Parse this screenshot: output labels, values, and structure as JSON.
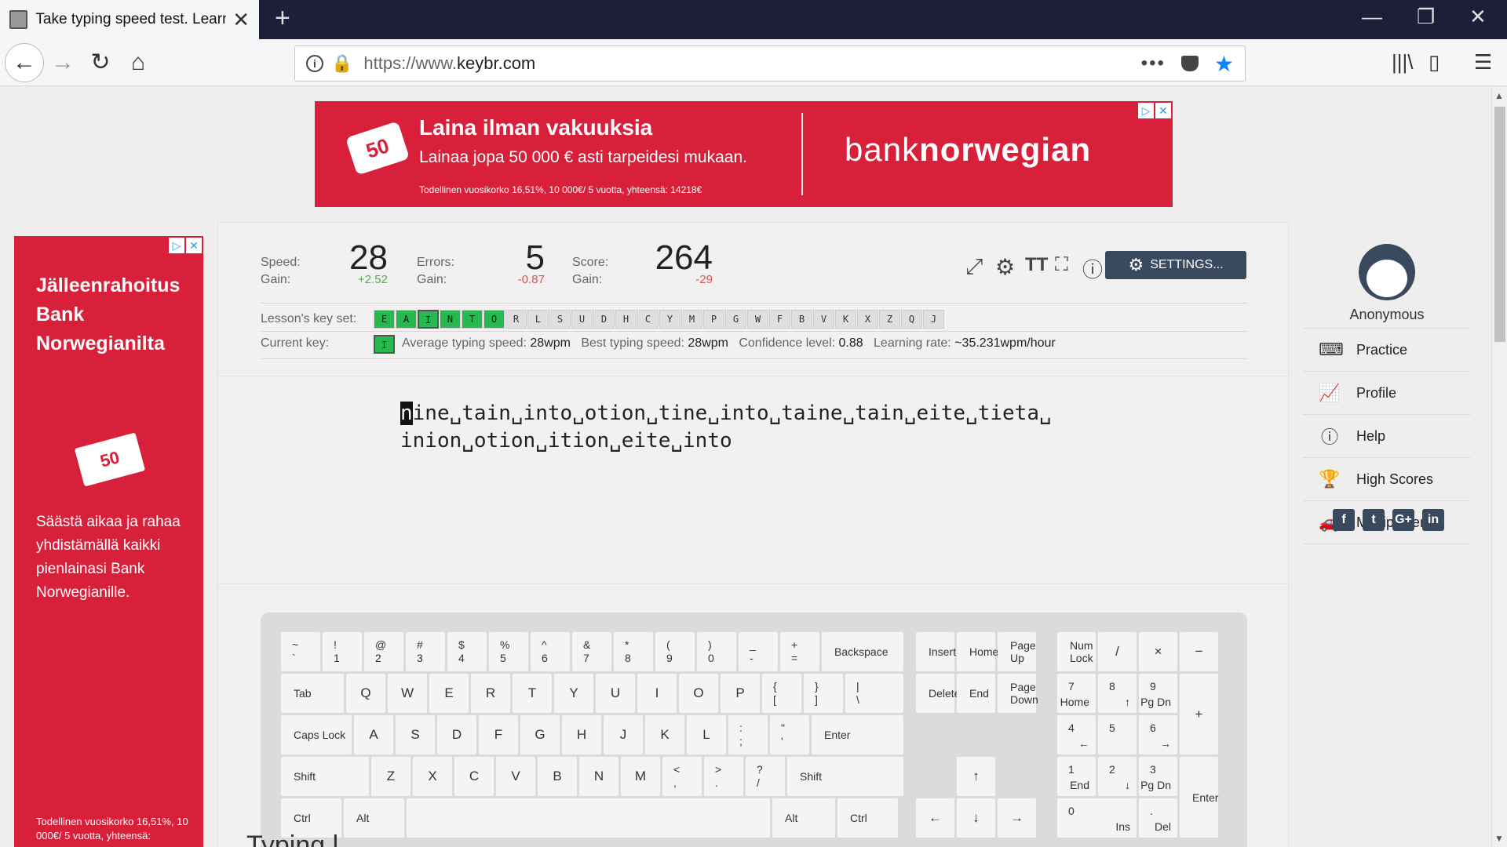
{
  "browser": {
    "tab_title": "Take typing speed test. Learn to",
    "url_prefix": "https://www.",
    "url_domain": "keybr.com",
    "new_tab": "+",
    "close_tab": "✕",
    "more": "•••"
  },
  "top_ad": {
    "title": "Laina ilman vakuuksia",
    "subtitle": "Lainaa jopa 50 000 € asti tarpeidesi mukaan.",
    "fine": "Todellinen vuosikorko 16,51%, 10 000€/ 5 vuotta, yhteensä: 14218€",
    "tag": "50",
    "brand_a": "bank",
    "brand_b": "norwegian"
  },
  "left_ad": {
    "headline": "Jälleenrahoitus Bank Norwegianilta",
    "card": "50",
    "body": "Säästä aikaa ja rahaa yhdistämällä kaikki pienlainasi Bank Norwegianille.",
    "fine": "Todellinen vuosikorko 16,51%, 10 000€/ 5 vuotta, yhteensä:"
  },
  "stats": {
    "speed_label": "Speed:",
    "speed": "28",
    "speed_gain_label": "Gain:",
    "speed_gain": "+2.52",
    "errors_label": "Errors:",
    "errors": "5",
    "errors_gain_label": "Gain:",
    "errors_gain": "-0.87",
    "score_label": "Score:",
    "score": "264",
    "score_gain_label": "Gain:",
    "score_gain": "-29"
  },
  "settings_label": "SETTINGS...",
  "lesson_keys_label": "Lesson's key set:",
  "lesson_keys": [
    "E",
    "A",
    "I",
    "N",
    "T",
    "O",
    "R",
    "L",
    "S",
    "U",
    "D",
    "H",
    "C",
    "Y",
    "M",
    "P",
    "G",
    "W",
    "F",
    "B",
    "V",
    "K",
    "X",
    "Z",
    "Q",
    "J"
  ],
  "lesson_keys_active": 6,
  "current_key_label": "Current key:",
  "current_key": "I",
  "info": {
    "avg_label": "Average typing speed:",
    "avg": "28wpm",
    "best_label": "Best typing speed:",
    "best": "28wpm",
    "conf_label": "Confidence level:",
    "conf": "0.88",
    "rate_label": "Learning rate:",
    "rate": "~35.231wpm/hour"
  },
  "lesson_text": {
    "cursor_char": "n",
    "line1_rest": "ine␣tain␣into␣otion␣tine␣into␣taine␣tain␣eite␣tieta␣",
    "line2": "inion␣otion␣ition␣eite␣into"
  },
  "keyboard": {
    "tab": "Tab",
    "caps": "Caps Lock",
    "shift": "Shift",
    "ctrl": "Ctrl",
    "alt": "Alt",
    "backspace": "Backspace",
    "enter": "Enter",
    "insert": "Insert",
    "home": "Home",
    "pageup": "Page Up",
    "delete": "Delete",
    "end": "End",
    "pagedown": "Page Down",
    "numlock": "Num Lock"
  },
  "sidebar": {
    "user": "Anonymous",
    "items": [
      {
        "label": "Practice",
        "icon": "keyboard-icon"
      },
      {
        "label": "Profile",
        "icon": "chart-icon"
      },
      {
        "label": "Help",
        "icon": "help-icon"
      },
      {
        "label": "High Scores",
        "icon": "trophy-icon"
      },
      {
        "label": "Multiplayer",
        "icon": "car-icon"
      }
    ],
    "social": [
      "f",
      "t",
      "G+",
      "in"
    ]
  },
  "partial_heading": "Typing l",
  "colors": {
    "ad_red": "#d8203a",
    "key_green": "#28b850",
    "dark_slate": "#3a4a5e",
    "gain_positive": "#58a75c",
    "gain_negative": "#d9534f"
  }
}
